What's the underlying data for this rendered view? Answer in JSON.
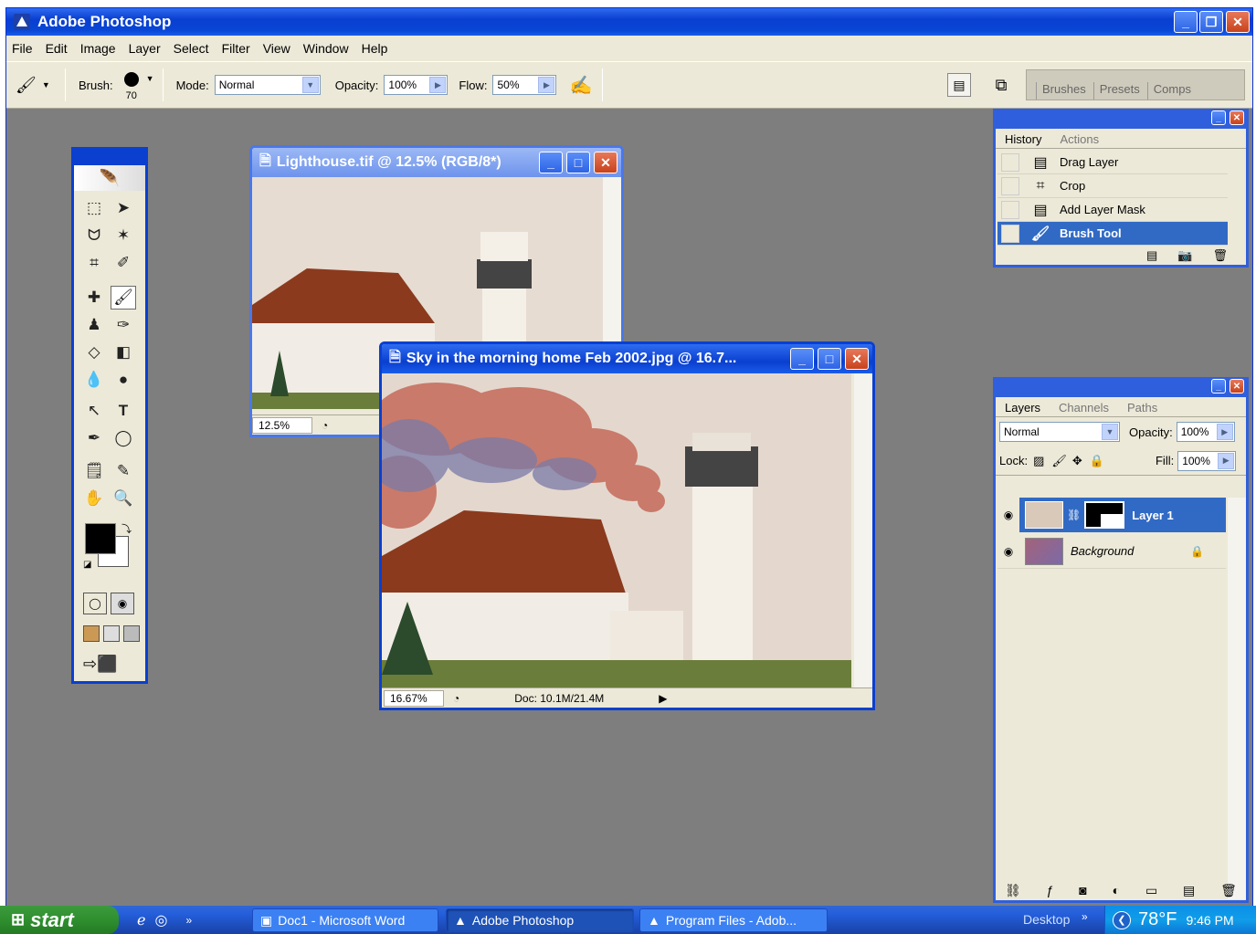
{
  "app": {
    "title": "Adobe Photoshop"
  },
  "menu": [
    "File",
    "Edit",
    "Image",
    "Layer",
    "Select",
    "Filter",
    "View",
    "Window",
    "Help"
  ],
  "options": {
    "brush_label": "Brush:",
    "brush_size": "70",
    "mode_label": "Mode:",
    "mode_value": "Normal",
    "opacity_label": "Opacity:",
    "opacity_value": "100%",
    "flow_label": "Flow:",
    "flow_value": "50%"
  },
  "wells": [
    "Brushes",
    "Presets",
    "Comps"
  ],
  "doc1": {
    "title": "Lighthouse.tif @ 12.5% (RGB/8*)",
    "zoom": "12.5%"
  },
  "doc2": {
    "title": "Sky in the morning home Feb 2002.jpg @ 16.7...",
    "zoom": "16.67%",
    "doc_info": "Doc: 10.1M/21.4M"
  },
  "history": {
    "tabs": [
      "History",
      "Actions"
    ],
    "items": [
      {
        "label": "Drag Layer",
        "icon": "history-state-icon"
      },
      {
        "label": "Crop",
        "icon": "crop-icon"
      },
      {
        "label": "Add Layer Mask",
        "icon": "history-state-icon"
      },
      {
        "label": "Brush Tool",
        "icon": "brush-icon"
      }
    ],
    "selected_index": 3
  },
  "layers": {
    "tabs": [
      "Layers",
      "Channels",
      "Paths"
    ],
    "blend_mode": "Normal",
    "opacity_label": "Opacity:",
    "opacity_value": "100%",
    "lock_label": "Lock:",
    "fill_label": "Fill:",
    "fill_value": "100%",
    "items": [
      {
        "name": "Layer 1",
        "selected": true
      },
      {
        "name": "Background",
        "selected": false
      }
    ]
  },
  "taskbar": {
    "start": "start",
    "tasks": [
      "Doc1 - Microsoft Word",
      "Adobe Photoshop",
      "Program Files - Adob..."
    ],
    "desktop": "Desktop",
    "temperature": "78°F",
    "time": "9:46 PM"
  }
}
